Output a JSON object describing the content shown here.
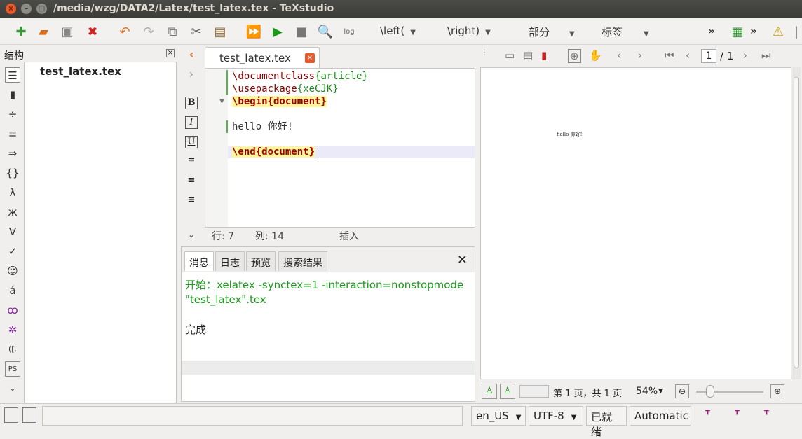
{
  "window": {
    "title": "/media/wzg/DATA2/Latex/test_latex.tex - TeXstudio"
  },
  "toolbar": {
    "left_combo": "\\left(",
    "right_combo": "\\right)",
    "section_combo": "部分",
    "label_combo": "标签",
    "overflow": "»"
  },
  "structure": {
    "title": "结构",
    "root_file": "test_latex.tex"
  },
  "sidebar_symbols": [
    "÷",
    "≡",
    "⇒",
    "{}",
    "λ",
    "ж",
    "∀",
    "✓",
    "☺",
    "á",
    "ꝏ",
    "✲",
    "([.",
    "PS"
  ],
  "format_buttons": [
    "B",
    "I",
    "U"
  ],
  "editor": {
    "tab_label": "test_latex.tex",
    "lines": {
      "l1_cmd": "\\documentclass",
      "l1_arg": "{article}",
      "l2_cmd": "\\usepackage",
      "l2_arg": "{xeCJK}",
      "l3": "\\begin{document}",
      "l5": "hello 你好!",
      "l7": "\\end{document}"
    },
    "status": {
      "row": "行: 7",
      "col": "列: 14",
      "mode": "插入"
    }
  },
  "messages": {
    "tabs": [
      "消息",
      "日志",
      "预览",
      "搜索结果"
    ],
    "line1": "开始：xelatex -synctex=1 -interaction=nonstopmode",
    "line2": "\"test_latex\".tex",
    "line3": "完成"
  },
  "pdf": {
    "page_current": "1",
    "page_total": "/ 1",
    "content": "hello 你好!",
    "page_info": "第 1 页，共 1 页",
    "zoom": "54%"
  },
  "statusbar": {
    "language": "en_US",
    "encoding": "UTF-8",
    "state": "已就绪",
    "mode": "Automatic"
  }
}
